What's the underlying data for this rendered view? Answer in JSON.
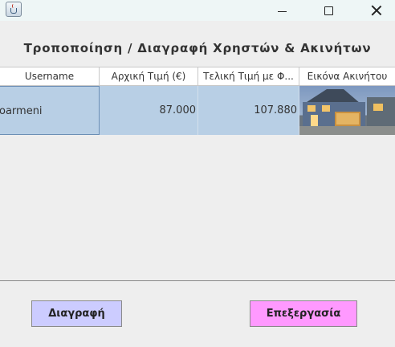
{
  "window": {
    "icon": "java-cup-icon",
    "controls": [
      "minimize-icon",
      "maximize-icon",
      "close-icon"
    ]
  },
  "page_title": "Τροποποίηση / Διαγραφή Χρηστών & Ακινήτων",
  "table": {
    "columns": [
      "Username",
      "Αρχική Τιμή (€)",
      "Τελική Τιμή με Φ...",
      "Εικόνα Ακινήτου"
    ],
    "rows": [
      {
        "username": "oarmeni",
        "initial_price": "87.000",
        "final_price": "107.880",
        "image": "house-photo"
      }
    ],
    "selected_row_color": "#b8cfe5"
  },
  "buttons": {
    "delete_label": "Διαγραφή",
    "delete_color": "#ccccff",
    "edit_label": "Επεξεργασία",
    "edit_color": "#ff99ff"
  }
}
